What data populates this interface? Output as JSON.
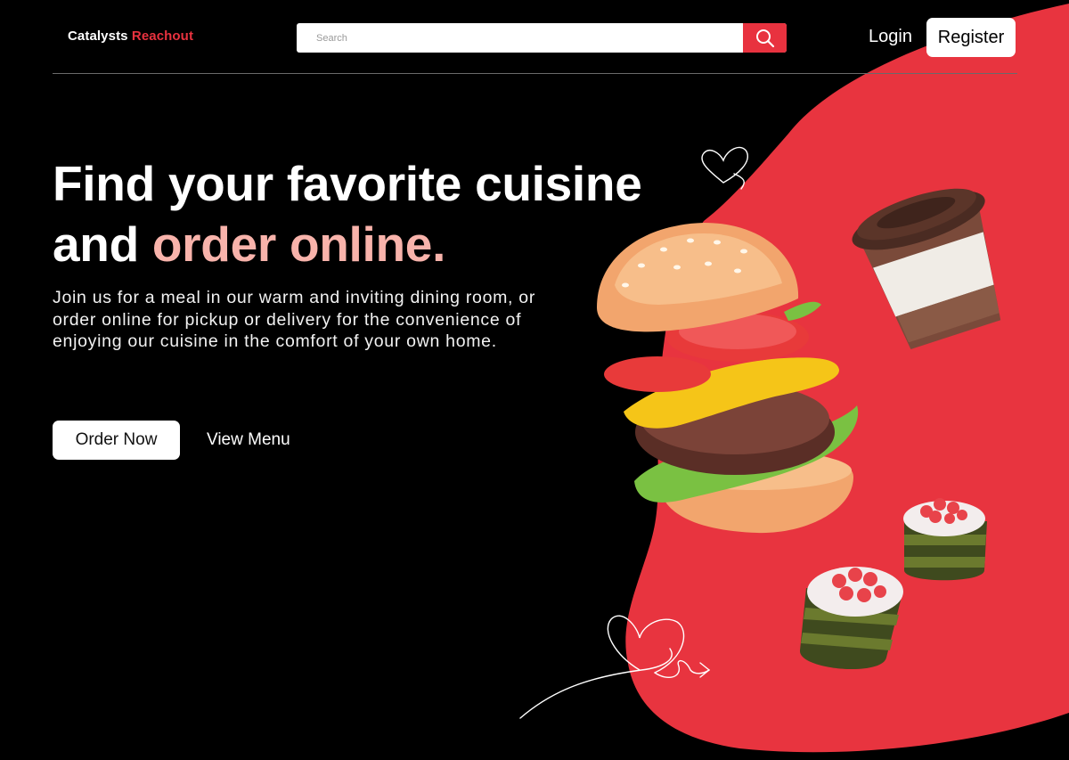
{
  "header": {
    "brand_primary": "Catalysts",
    "brand_accent": "Reachout",
    "search_placeholder": "Search",
    "login_label": "Login",
    "register_label": "Register"
  },
  "hero": {
    "headline_line1": "Find your favorite cuisine",
    "headline_line2_prefix": "and ",
    "headline_line2_highlight": "order online.",
    "description": "Join us for a meal in our warm and inviting dining room, or order online for pickup or delivery for the convenience of enjoying our cuisine in the comfort of your own home.",
    "order_button_label": "Order Now",
    "menu_link_label": "View Menu"
  },
  "illustration": {
    "items": [
      "burger-icon",
      "coffee-cup-icon",
      "sushi-roll-icon",
      "heart-doodle-icon"
    ]
  },
  "colors": {
    "accent": "#e8323f",
    "highlight": "#f8b3ab",
    "background": "#000000",
    "blob": "#e8343f"
  }
}
